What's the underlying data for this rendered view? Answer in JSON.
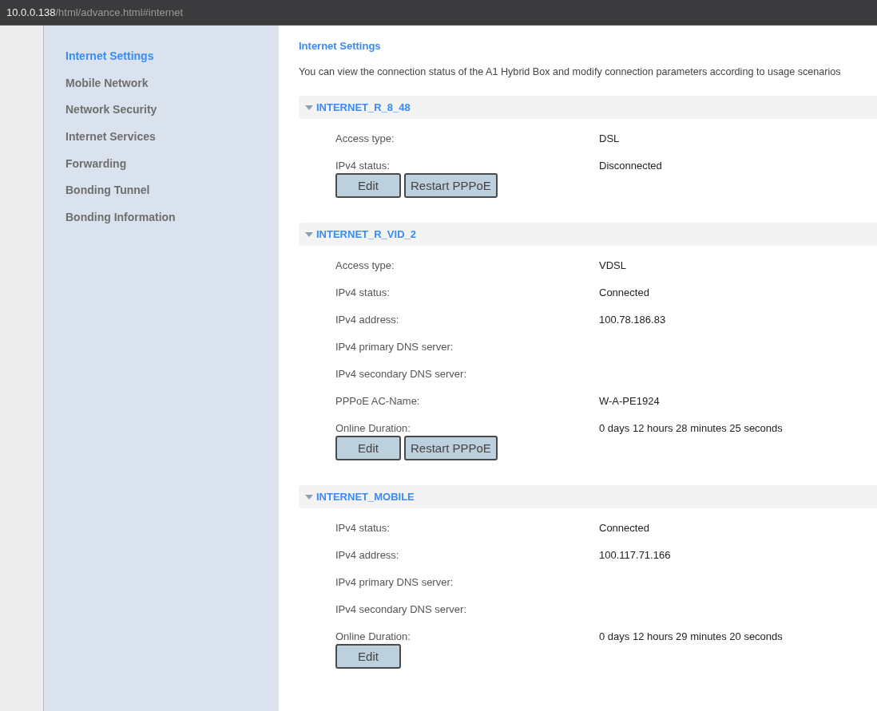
{
  "address_bar": {
    "host": "10.0.0.138",
    "path": "/html/advance.html#internet"
  },
  "sidebar": {
    "items": [
      {
        "label": "Internet Settings",
        "selected": true
      },
      {
        "label": "Mobile Network",
        "selected": false
      },
      {
        "label": "Network Security",
        "selected": false
      },
      {
        "label": "Internet Services",
        "selected": false
      },
      {
        "label": "Forwarding",
        "selected": false
      },
      {
        "label": "Bonding Tunnel",
        "selected": false
      },
      {
        "label": "Bonding Information",
        "selected": false
      }
    ]
  },
  "page": {
    "title": "Internet Settings",
    "description": "You can view the connection status of the A1 Hybrid Box and modify connection parameters according to usage scenarios"
  },
  "sections": [
    {
      "name": "INTERNET_R_8_48",
      "expanded": true,
      "fields": [
        {
          "label": "Access type:",
          "value": "DSL"
        },
        {
          "label": "IPv4 status:",
          "value": "Disconnected"
        }
      ],
      "buttons": [
        "Edit",
        "Restart PPPoE"
      ]
    },
    {
      "name": "INTERNET_R_VID_2",
      "expanded": true,
      "fields": [
        {
          "label": "Access type:",
          "value": "VDSL"
        },
        {
          "label": "IPv4 status:",
          "value": "Connected"
        },
        {
          "label": "IPv4 address:",
          "value": "100.78.186.83"
        },
        {
          "label": "IPv4 primary DNS server:"
        },
        {
          "label": "IPv4 secondary DNS server:"
        },
        {
          "label": "PPPoE AC-Name:",
          "value": "W-A-PE1924"
        },
        {
          "label": "Online Duration:",
          "value": "0 days 12 hours 28 minutes 25 seconds"
        }
      ],
      "buttons": [
        "Edit",
        "Restart PPPoE"
      ]
    },
    {
      "name": "INTERNET_MOBILE",
      "expanded": true,
      "fields": [
        {
          "label": "IPv4 status:",
          "value": "Connected"
        },
        {
          "label": "IPv4 address:",
          "value": "100.117.71.166"
        },
        {
          "label": "IPv4 primary DNS server:"
        },
        {
          "label": "IPv4 secondary DNS server:"
        },
        {
          "label": "Online Duration:",
          "value": "0 days 12 hours 29 minutes 20 seconds"
        }
      ],
      "buttons": [
        "Edit"
      ]
    }
  ]
}
